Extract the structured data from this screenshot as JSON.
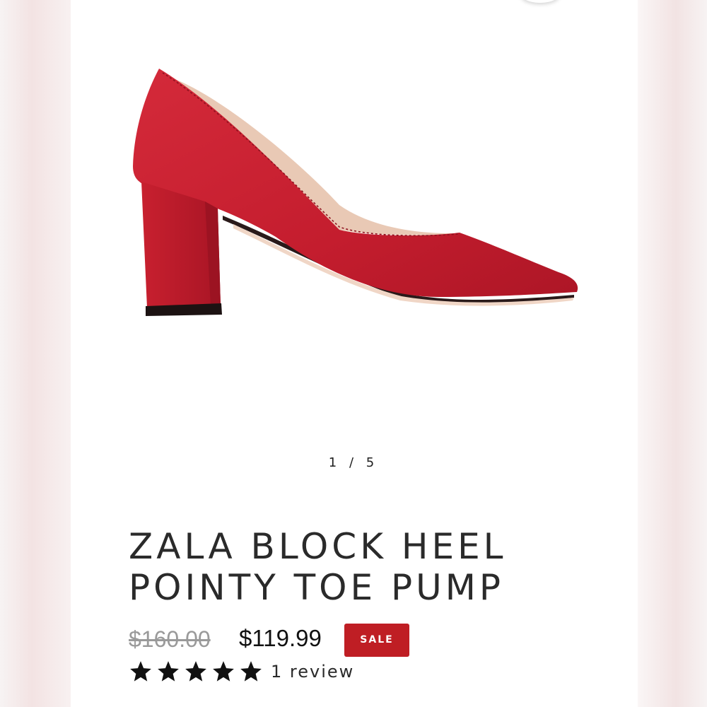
{
  "gallery": {
    "image_alt": "Red suede block heel pointy toe pump",
    "shoe_color": "#c41d2e",
    "current": "1",
    "separator": "/",
    "total": "5"
  },
  "product": {
    "title_line1": "ZALA BLOCK HEEL",
    "title_line2": "POINTY TOE PUMP",
    "original_price": "$160.00",
    "sale_price": "$119.99",
    "badge": "SALE",
    "rating": 5,
    "rating_max": 5,
    "review_text": "1 review"
  },
  "colors": {
    "sale_badge": "#bf1e24",
    "text": "#2a2a2a",
    "strike_price": "#9a9a9a"
  }
}
